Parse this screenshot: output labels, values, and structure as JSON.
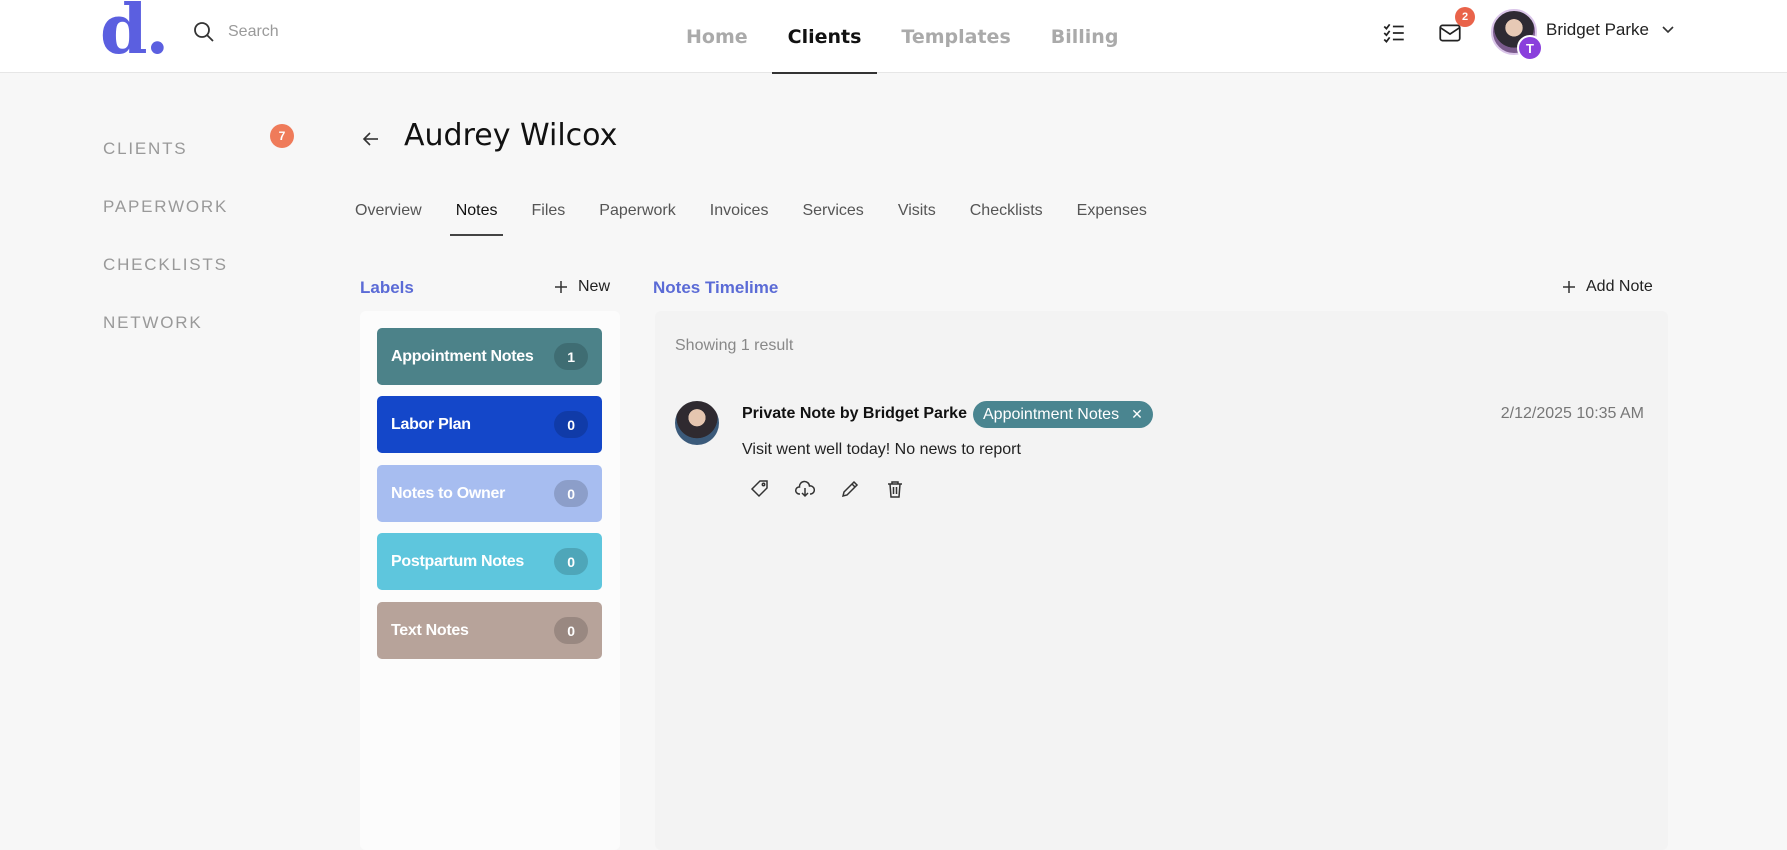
{
  "header": {
    "logo": "d.",
    "search_placeholder": "Search",
    "nav": [
      {
        "label": "Home",
        "active": false
      },
      {
        "label": "Clients",
        "active": true
      },
      {
        "label": "Templates",
        "active": false
      },
      {
        "label": "Billing",
        "active": false
      }
    ],
    "inbox_count": "2",
    "user": {
      "name": "Bridget Parke",
      "initial": "T"
    }
  },
  "sidebar": {
    "items": [
      {
        "label": "CLIENTS",
        "badge": "7"
      },
      {
        "label": "PAPERWORK"
      },
      {
        "label": "CHECKLISTS"
      },
      {
        "label": "NETWORK"
      }
    ]
  },
  "client": {
    "name": "Audrey Wilcox"
  },
  "tabs": [
    "Overview",
    "Notes",
    "Files",
    "Paperwork",
    "Invoices",
    "Services",
    "Visits",
    "Checklists",
    "Expenses"
  ],
  "active_tab": "Notes",
  "labels": {
    "title": "Labels",
    "new_label": "New",
    "items": [
      {
        "name": "Appointment Notes",
        "count": "1",
        "color": "#4c8289"
      },
      {
        "name": "Labor Plan",
        "count": "0",
        "color": "#1447c9"
      },
      {
        "name": "Notes to Owner",
        "count": "0",
        "color": "#a7bdf0"
      },
      {
        "name": "Postpartum Notes",
        "count": "0",
        "color": "#5ec6dd"
      },
      {
        "name": "Text Notes",
        "count": "0",
        "color": "#b7a39a"
      }
    ]
  },
  "notes": {
    "title": "Notes Timelime",
    "add_label": "Add Note",
    "showing": "Showing 1 result",
    "items": [
      {
        "author": "Private Note by Bridget Parke",
        "tag": "Appointment Notes",
        "tag_color": "#4a8590",
        "date": "2/12/2025 10:35 AM",
        "text": "Visit went well today! No news to report"
      }
    ]
  },
  "colors": {
    "accent": "#5b6bd6",
    "logo": "#5b5fe0",
    "badge": "#e9634a"
  }
}
